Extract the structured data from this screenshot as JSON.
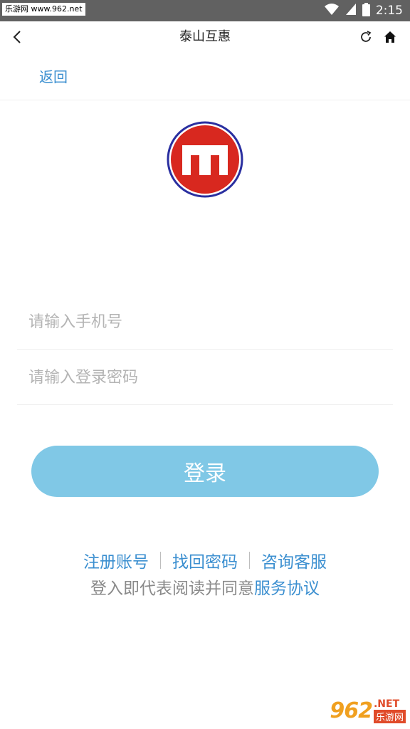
{
  "status_bar": {
    "watermark": "乐游网 www.962.net",
    "time": "2:15"
  },
  "title_bar": {
    "title": "泰山互惠"
  },
  "sub_nav": {
    "return_label": "返回"
  },
  "login_form": {
    "phone_placeholder": "请输入手机号",
    "password_placeholder": "请输入登录密码",
    "login_label": "登录"
  },
  "links": {
    "register": "注册账号",
    "recover_password": "找回密码",
    "customer_service": "咨询客服"
  },
  "agreement": {
    "prefix": "登入即代表阅读并同意",
    "protocol": "服务协议"
  },
  "bottom_watermark": {
    "logo": "962",
    "suffix": ".NET",
    "name": "乐游网"
  },
  "colors": {
    "accent": "#3b8fd0",
    "button": "#80c8e6",
    "logo_red": "#d8281f",
    "logo_ring": "#2a2fa0"
  }
}
